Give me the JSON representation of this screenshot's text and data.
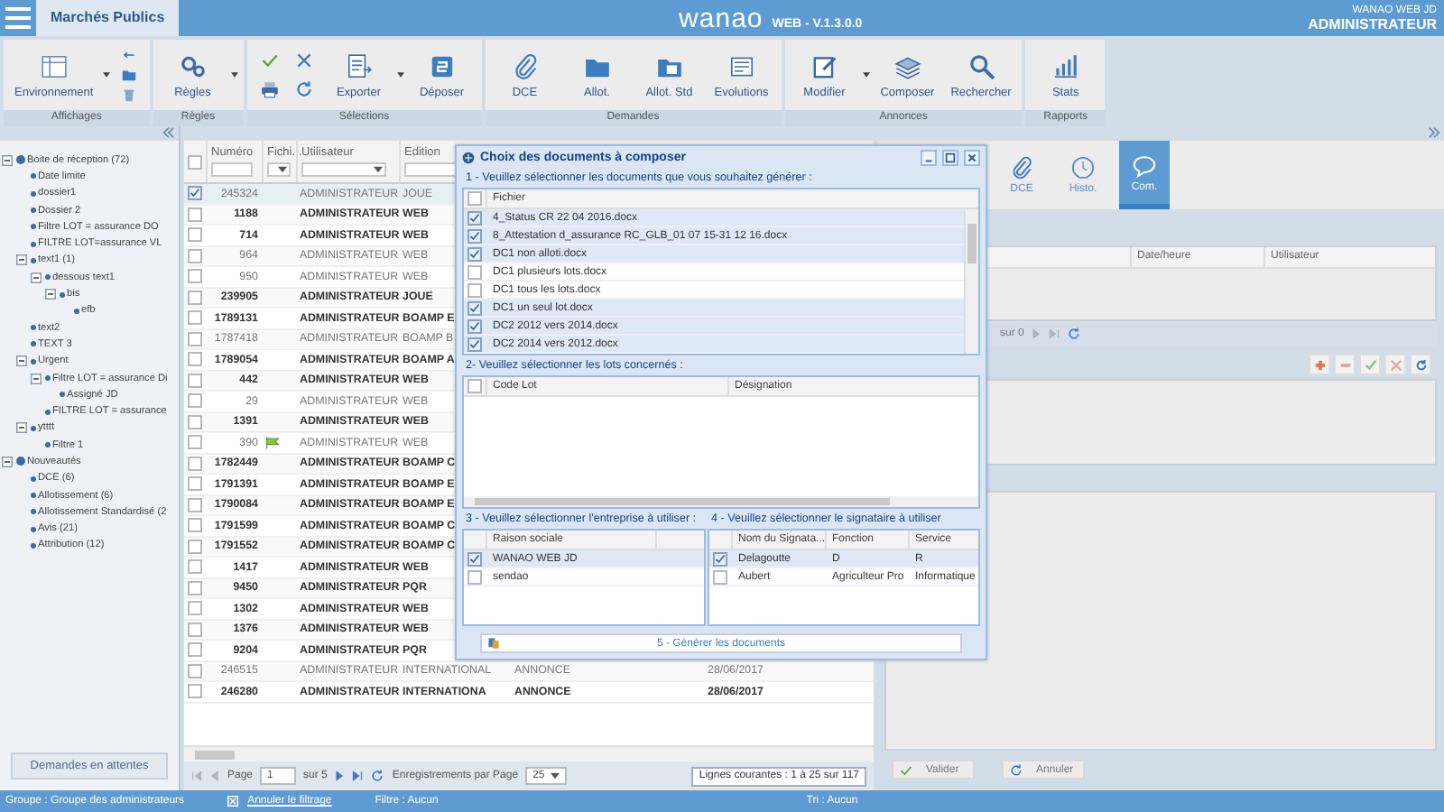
{
  "header": {
    "app_tab": "Marchés Publics",
    "logo": "wanao",
    "version": "WEB - V.1.3.0.0",
    "org": "WANAO WEB JD",
    "role": "ADMINISTRATEUR"
  },
  "toolbar": [
    {
      "label": "Affichages",
      "items": [
        {
          "kind": "table",
          "label": "Environnement",
          "dropdown": true
        },
        {
          "kind": "back"
        },
        {
          "kind": "folder"
        },
        {
          "kind": "trash"
        }
      ]
    },
    {
      "label": "Règles",
      "items": [
        {
          "kind": "gears",
          "label": "Règles",
          "dropdown": true
        }
      ]
    },
    {
      "label": "Sélections",
      "items": [
        {
          "kind": "check"
        },
        {
          "kind": "print"
        },
        {
          "kind": "cross"
        },
        {
          "kind": "refresh"
        },
        {
          "kind": "export",
          "label": "Exporter",
          "dropdown": true
        },
        {
          "kind": "deposit",
          "label": "Déposer",
          "dropdown": false
        }
      ]
    },
    {
      "label": "Demandes",
      "items": [
        {
          "kind": "clip",
          "label": "DCE",
          "dropdown": false
        },
        {
          "kind": "folder",
          "label": "Allot.",
          "dropdown": false
        },
        {
          "kind": "folder-doc",
          "label": "Allot. Std",
          "dropdown": false
        },
        {
          "kind": "news",
          "label": "Evolutions",
          "dropdown": false
        }
      ]
    },
    {
      "label": "Annonces",
      "items": [
        {
          "kind": "edit",
          "label": "Modifier",
          "dropdown": true
        },
        {
          "kind": "layers",
          "label": "Composer",
          "dropdown": false
        },
        {
          "kind": "search",
          "label": "Rechercher",
          "dropdown": false
        }
      ]
    },
    {
      "label": "Rapports",
      "items": [
        {
          "kind": "bars",
          "label": "Stats",
          "dropdown": false
        }
      ]
    }
  ],
  "tree": [
    {
      "label": "Boite de réception (72)",
      "expanded": true,
      "children": [
        {
          "label": "Date limite"
        },
        {
          "label": "dossier1"
        },
        {
          "label": "Dossier 2"
        },
        {
          "label": "Filtre LOT = assurance DO"
        },
        {
          "label": "FILTRE LOT=assurance VL"
        },
        {
          "label": "text1 (1)",
          "expanded": true,
          "children": [
            {
              "label": "dessous text1",
              "expanded": true,
              "children": [
                {
                  "label": "bis",
                  "expanded": true,
                  "children": [
                    {
                      "label": "efb"
                    }
                  ]
                }
              ]
            }
          ]
        },
        {
          "label": "text2"
        },
        {
          "label": "TEXT 3"
        },
        {
          "label": "Urgent",
          "expanded": true,
          "children": [
            {
              "label": "Filtre LOT = assurance Di",
              "expanded": true,
              "children": [
                {
                  "label": "Assigné JD"
                }
              ]
            },
            {
              "label": "FILTRE LOT = assurance"
            }
          ]
        },
        {
          "label": "ytttt",
          "expanded": true,
          "children": [
            {
              "label": "Filtre 1"
            }
          ]
        }
      ]
    },
    {
      "label": "Nouveautés",
      "expanded": true,
      "children": [
        {
          "label": "DCE (6)"
        },
        {
          "label": "Allotissement (6)"
        },
        {
          "label": "Allotissement Standardisé (2"
        },
        {
          "label": "Avis (21)"
        },
        {
          "label": "Attribution (12)"
        }
      ]
    }
  ],
  "pending_button": "Demandes en attentes",
  "grid": {
    "select_all": false,
    "columns": [
      "Numéro",
      "Fichi...",
      "Utilisateur",
      "Edition"
    ],
    "rows": [
      {
        "checked": true,
        "unread": false,
        "flagged": false,
        "numero": "245324",
        "user": "ADMINISTRATEUR",
        "edition": "JOUE"
      },
      {
        "checked": false,
        "unread": true,
        "flagged": false,
        "numero": "1188",
        "user": "ADMINISTRATEUR",
        "edition": "WEB"
      },
      {
        "checked": false,
        "unread": true,
        "flagged": false,
        "numero": "714",
        "user": "ADMINISTRATEUR",
        "edition": "WEB"
      },
      {
        "checked": false,
        "unread": false,
        "flagged": false,
        "numero": "964",
        "user": "ADMINISTRATEUR",
        "edition": "WEB"
      },
      {
        "checked": false,
        "unread": false,
        "flagged": false,
        "numero": "950",
        "user": "ADMINISTRATEUR",
        "edition": "WEB"
      },
      {
        "checked": false,
        "unread": true,
        "flagged": false,
        "numero": "239905",
        "user": "ADMINISTRATEUR",
        "edition": "JOUE"
      },
      {
        "checked": false,
        "unread": true,
        "flagged": false,
        "numero": "1789131",
        "user": "ADMINISTRATEUR",
        "edition": "BOAMP E"
      },
      {
        "checked": false,
        "unread": false,
        "flagged": false,
        "numero": "1787418",
        "user": "ADMINISTRATEUR",
        "edition": "BOAMP B"
      },
      {
        "checked": false,
        "unread": true,
        "flagged": false,
        "numero": "1789054",
        "user": "ADMINISTRATEUR",
        "edition": "BOAMP A"
      },
      {
        "checked": false,
        "unread": true,
        "flagged": false,
        "numero": "442",
        "user": "ADMINISTRATEUR",
        "edition": "WEB"
      },
      {
        "checked": false,
        "unread": false,
        "flagged": false,
        "numero": "29",
        "user": "ADMINISTRATEUR",
        "edition": "WEB"
      },
      {
        "checked": false,
        "unread": true,
        "flagged": false,
        "numero": "1391",
        "user": "ADMINISTRATEUR",
        "edition": "WEB"
      },
      {
        "checked": false,
        "unread": false,
        "flagged": true,
        "numero": "390",
        "user": "ADMINISTRATEUR",
        "edition": "WEB"
      },
      {
        "checked": false,
        "unread": true,
        "flagged": false,
        "numero": "1782449",
        "user": "ADMINISTRATEUR",
        "edition": "BOAMP C"
      },
      {
        "checked": false,
        "unread": true,
        "flagged": false,
        "numero": "1791391",
        "user": "ADMINISTRATEUR",
        "edition": "BOAMP E"
      },
      {
        "checked": false,
        "unread": true,
        "flagged": false,
        "numero": "1790084",
        "user": "ADMINISTRATEUR",
        "edition": "BOAMP E"
      },
      {
        "checked": false,
        "unread": true,
        "flagged": false,
        "numero": "1791599",
        "user": "ADMINISTRATEUR",
        "edition": "BOAMP C"
      },
      {
        "checked": false,
        "unread": true,
        "flagged": false,
        "numero": "1791552",
        "user": "ADMINISTRATEUR",
        "edition": "BOAMP C"
      },
      {
        "checked": false,
        "unread": true,
        "flagged": false,
        "numero": "1417",
        "user": "ADMINISTRATEUR",
        "edition": "WEB"
      },
      {
        "checked": false,
        "unread": true,
        "flagged": false,
        "numero": "9450",
        "user": "ADMINISTRATEUR",
        "edition": "PQR"
      },
      {
        "checked": false,
        "unread": true,
        "flagged": false,
        "numero": "1302",
        "user": "ADMINISTRATEUR",
        "edition": "WEB"
      },
      {
        "checked": false,
        "unread": true,
        "flagged": false,
        "numero": "1376",
        "user": "ADMINISTRATEUR",
        "edition": "WEB"
      },
      {
        "checked": false,
        "unread": true,
        "flagged": false,
        "numero": "9204",
        "user": "ADMINISTRATEUR",
        "edition": "PQR"
      },
      {
        "checked": false,
        "unread": false,
        "flagged": false,
        "numero": "246515",
        "user": "ADMINISTRATEUR",
        "edition": "INTERNATIONAL",
        "type": "ANNONCE",
        "date": "28/06/2017"
      },
      {
        "checked": false,
        "unread": true,
        "flagged": false,
        "numero": "246280",
        "user": "ADMINISTRATEUR",
        "edition": "INTERNATIONA",
        "type": "ANNONCE",
        "date": "28/06/2017"
      }
    ],
    "pager": {
      "page_label": "Page",
      "page": "1",
      "of": "sur 5",
      "per_page_label": "Enregistrements par Page",
      "per_page": "25",
      "summary": "Lignes courantes : 1 à 25 sur 117"
    }
  },
  "detail": {
    "tabs": [
      {
        "kind": "clip",
        "label": "DCE",
        "selected": false
      },
      {
        "kind": "clock",
        "label": "Histo.",
        "selected": false
      },
      {
        "kind": "bubble",
        "label": "Com.",
        "selected": true
      }
    ],
    "columns": [
      "Date/heure",
      "Utilisateur"
    ],
    "pager_of": "sur 0",
    "buttons": [
      {
        "kind": "check",
        "label": "Valider"
      },
      {
        "kind": "refresh",
        "label": "Annuler"
      }
    ]
  },
  "dialog": {
    "title": "Choix des documents à composer",
    "step1": "1 - Veuillez sélectionner les documents que vous souhaitez générer :",
    "files_select_all": false,
    "file_column": "Fichier",
    "files": [
      {
        "name": "4_Status CR 22 04 2016.docx",
        "checked": true
      },
      {
        "name": "8_Attestation d_assurance RC_GLB_01 07 15-31 12 16.docx",
        "checked": true
      },
      {
        "name": "DC1 non alloti.docx",
        "checked": true
      },
      {
        "name": "DC1 plusieurs lots.docx",
        "checked": false
      },
      {
        "name": "DC1 tous les lots.docx",
        "checked": false
      },
      {
        "name": "DC1 un seul lot.docx",
        "checked": true
      },
      {
        "name": "DC2 2012 vers 2014.docx",
        "checked": true
      },
      {
        "name": "DC2 2014 vers 2012.docx",
        "checked": true
      }
    ],
    "step2": "2- Veuillez sélectionner les lots concernés :",
    "lots_select_all": false,
    "lot_columns": [
      "Code Lot",
      "Désignation"
    ],
    "step3": "3 - Veuillez sélectionner l'entreprise à utiliser :",
    "company_column": "Raison sociale",
    "companies": [
      {
        "name": "WANAO WEB JD",
        "checked": true
      },
      {
        "name": "sendao",
        "checked": false
      }
    ],
    "step4": "4 - Veuillez sélectionner le signataire à utiliser",
    "signer_columns": [
      "Nom du Signata...",
      "Fonction",
      "Service"
    ],
    "signers": [
      {
        "checked": true,
        "cells": [
          "Delagoutte",
          "D",
          "R"
        ]
      },
      {
        "checked": false,
        "cells": [
          "Aubert",
          "Agriculteur Pro",
          "Informatique"
        ]
      }
    ],
    "generate": "5 - Générer les documents"
  },
  "status": {
    "group": "Groupe : Groupe des administrateurs",
    "clear_filter": "Annuler le filtrage",
    "filter": "Filtre : Aucun",
    "sort": "Tri : Aucun"
  }
}
